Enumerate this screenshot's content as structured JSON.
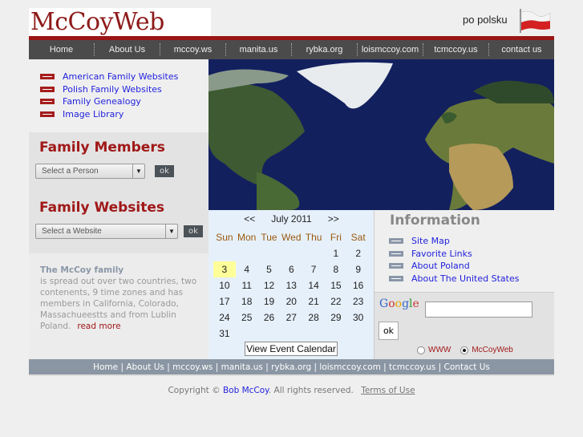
{
  "header": {
    "logo": "McCoyWeb",
    "language_link": "po polsku"
  },
  "nav": [
    "Home",
    "About Us",
    "mccoy.ws",
    "manita.us",
    "rybka.org",
    "loismccoy.com",
    "tcmccoy.us",
    "contact us"
  ],
  "quick_links": [
    "American Family Websites",
    "Polish Family Websites",
    "Family Genealogy",
    "Image Library"
  ],
  "members": {
    "title": "Family Members",
    "select": "Select a Person",
    "ok": "ok"
  },
  "websites": {
    "title": "Family Websites",
    "select": "Select a Website",
    "ok": "ok"
  },
  "about": {
    "title": "The McCoy family",
    "text": "is spread out over two countries, two contenents, 9 time zones and has members in California, Colorado, Massachueestts and from Lublin Poland.",
    "more": "read more"
  },
  "calendar": {
    "prev": "<<",
    "month": "July 2011",
    "next": ">>",
    "days": [
      "Sun",
      "Mon",
      "Tue",
      "Wed",
      "Thu",
      "Fri",
      "Sat"
    ],
    "today": 3,
    "button": "View Event Calendar"
  },
  "info": {
    "title": "Information",
    "links": [
      "Site Map",
      "Favorite Links",
      "About Poland",
      "About The United States"
    ]
  },
  "search": {
    "logo": "Google",
    "ok": "ok",
    "options": [
      "WWW",
      "McCoyWeb"
    ],
    "selected": "McCoyWeb"
  },
  "footer_nav": [
    "Home",
    "About Us",
    "mccoy.ws",
    "manita.us",
    "rybka.org",
    "loismccoy.com",
    "tcmccoy.us",
    "Contact Us"
  ],
  "copyright": {
    "prefix": "Copyright ©",
    "owner": "Bob McCoy",
    "suffix": ". All rights reserved.",
    "terms": "Terms of Use"
  },
  "colors": {
    "brand_red": "#9b1515",
    "nav_bg": "#4b4b4b",
    "link": "#2222dd"
  }
}
